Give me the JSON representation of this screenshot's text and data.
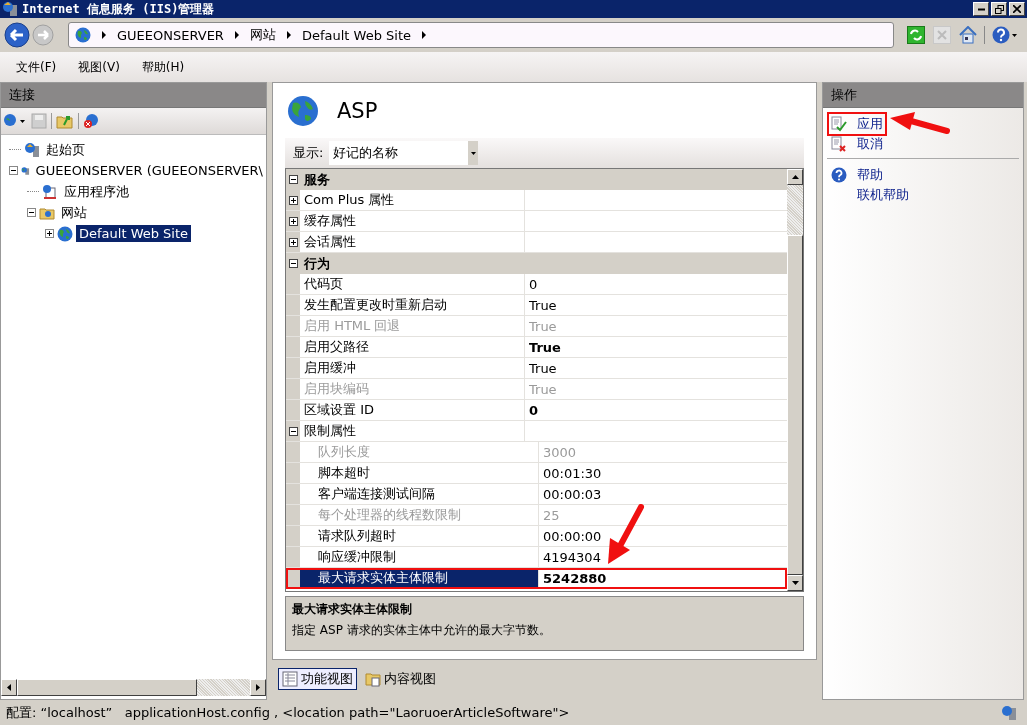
{
  "window": {
    "title": "Internet 信息服务 (IIS)管理器"
  },
  "breadcrumb": [
    "GUEEONSERVER",
    "网站",
    "Default Web Site"
  ],
  "menu": [
    "文件(F)",
    "视图(V)",
    "帮助(H)"
  ],
  "connections": {
    "title": "连接",
    "tree": [
      {
        "label": "起始页",
        "selected": false
      },
      {
        "label": "GUEEONSERVER (GUEEONSERVER\\",
        "expanded": true,
        "selected": false,
        "children": [
          {
            "label": "应用程序池",
            "selected": false
          },
          {
            "label": "网站",
            "expanded": true,
            "selected": false,
            "children": [
              {
                "label": "Default Web Site",
                "expanded": false,
                "selected": true
              }
            ]
          }
        ]
      }
    ]
  },
  "feature": {
    "title": "ASP",
    "filter": {
      "label": "显示:",
      "value": "好记的名称"
    },
    "categories": [
      {
        "name": "服务",
        "expanded": true,
        "items": [
          {
            "name": "Com Plus 属性",
            "expanded": false,
            "disabled": false,
            "selected": false
          },
          {
            "name": "缓存属性",
            "expanded": false,
            "disabled": false,
            "selected": false
          },
          {
            "name": "会话属性",
            "expanded": false,
            "disabled": false,
            "selected": false
          }
        ]
      },
      {
        "name": "行为",
        "expanded": true,
        "items": [
          {
            "name": "代码页",
            "value": "0",
            "disabled": false,
            "modified": false,
            "selected": false
          },
          {
            "name": "发生配置更改时重新启动",
            "value": "True",
            "disabled": false,
            "modified": false,
            "selected": false
          },
          {
            "name": "启用 HTML 回退",
            "value": "True",
            "disabled": true,
            "modified": false,
            "selected": false
          },
          {
            "name": "启用父路径",
            "value": "True",
            "disabled": false,
            "modified": true,
            "selected": false
          },
          {
            "name": "启用缓冲",
            "value": "True",
            "disabled": false,
            "modified": false,
            "selected": false
          },
          {
            "name": "启用块编码",
            "value": "True",
            "disabled": true,
            "modified": false,
            "selected": false
          },
          {
            "name": "区域设置 ID",
            "value": "0",
            "disabled": false,
            "modified": true,
            "selected": false
          },
          {
            "name": "限制属性",
            "expanded": true,
            "disabled": false,
            "selected": false,
            "children": [
              {
                "name": "队列长度",
                "value": "3000",
                "disabled": true,
                "modified": false,
                "selected": false
              },
              {
                "name": "脚本超时",
                "value": "00:01:30",
                "disabled": false,
                "modified": false,
                "selected": false
              },
              {
                "name": "客户端连接测试间隔",
                "value": "00:00:03",
                "disabled": false,
                "modified": false,
                "selected": false
              },
              {
                "name": "每个处理器的线程数限制",
                "value": "25",
                "disabled": true,
                "modified": false,
                "selected": false
              },
              {
                "name": "请求队列超时",
                "value": "00:00:00",
                "disabled": false,
                "modified": false,
                "selected": false
              },
              {
                "name": "响应缓冲限制",
                "value": "4194304",
                "disabled": false,
                "modified": false,
                "selected": false
              },
              {
                "name": "最大请求实体主体限制",
                "value": "5242880",
                "disabled": false,
                "modified": true,
                "selected": true,
                "highlighted": true
              }
            ]
          }
        ]
      }
    ],
    "description": {
      "title": "最大请求实体主体限制",
      "text": "指定 ASP 请求的实体主体中允许的最大字节数。"
    }
  },
  "view_tabs": [
    {
      "label": "功能视图",
      "selected": true
    },
    {
      "label": "内容视图",
      "selected": false
    }
  ],
  "actions": {
    "title": "操作",
    "groups": [
      [
        {
          "label": "应用",
          "highlighted": true
        },
        {
          "label": "取消",
          "highlighted": false
        }
      ],
      [
        {
          "label": "帮助",
          "highlighted": false
        },
        {
          "label": "联机帮助",
          "highlighted": false
        }
      ]
    ]
  },
  "status_bar": "配置: “localhost”   applicationHost.config , <location path=\"LaoruoerArticleSoftware\">"
}
